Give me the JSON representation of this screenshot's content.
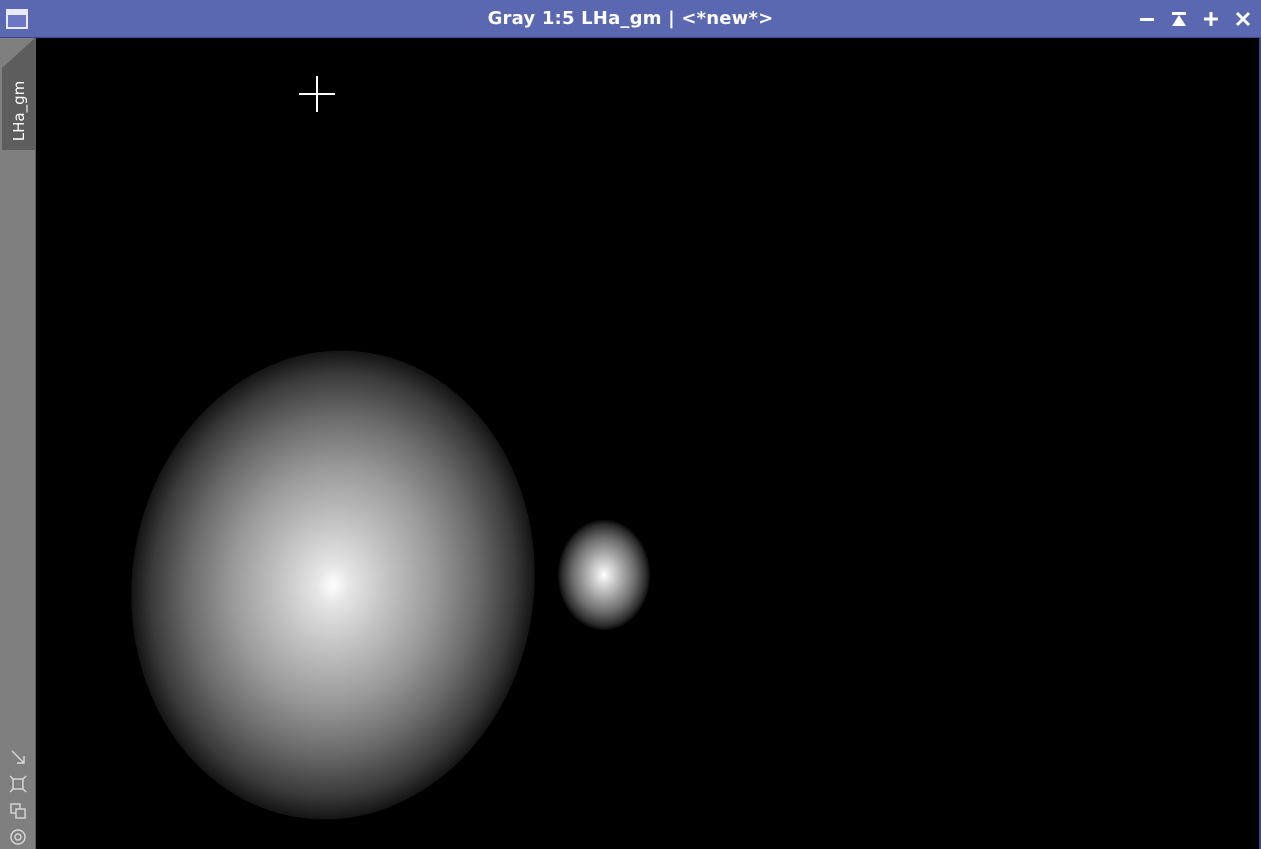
{
  "window": {
    "title": "Gray 1:5 LHa_gm | <*new*>",
    "titlebar_color": "#5a67b1",
    "icons": {
      "window_menu": "window-icon",
      "minimize": "minimize-icon",
      "shade": "shade-icon",
      "maximize": "maximize-icon",
      "close": "close-icon"
    }
  },
  "sidebar": {
    "view_tab_label": "LHa_gm",
    "tools": [
      {
        "icon": "drag-arrow-icon"
      },
      {
        "icon": "frame-icon"
      },
      {
        "icon": "clone-icon"
      },
      {
        "icon": "target-icon"
      }
    ]
  },
  "canvas": {
    "background_color": "#000000",
    "cursor": "crosshair-cursor"
  }
}
